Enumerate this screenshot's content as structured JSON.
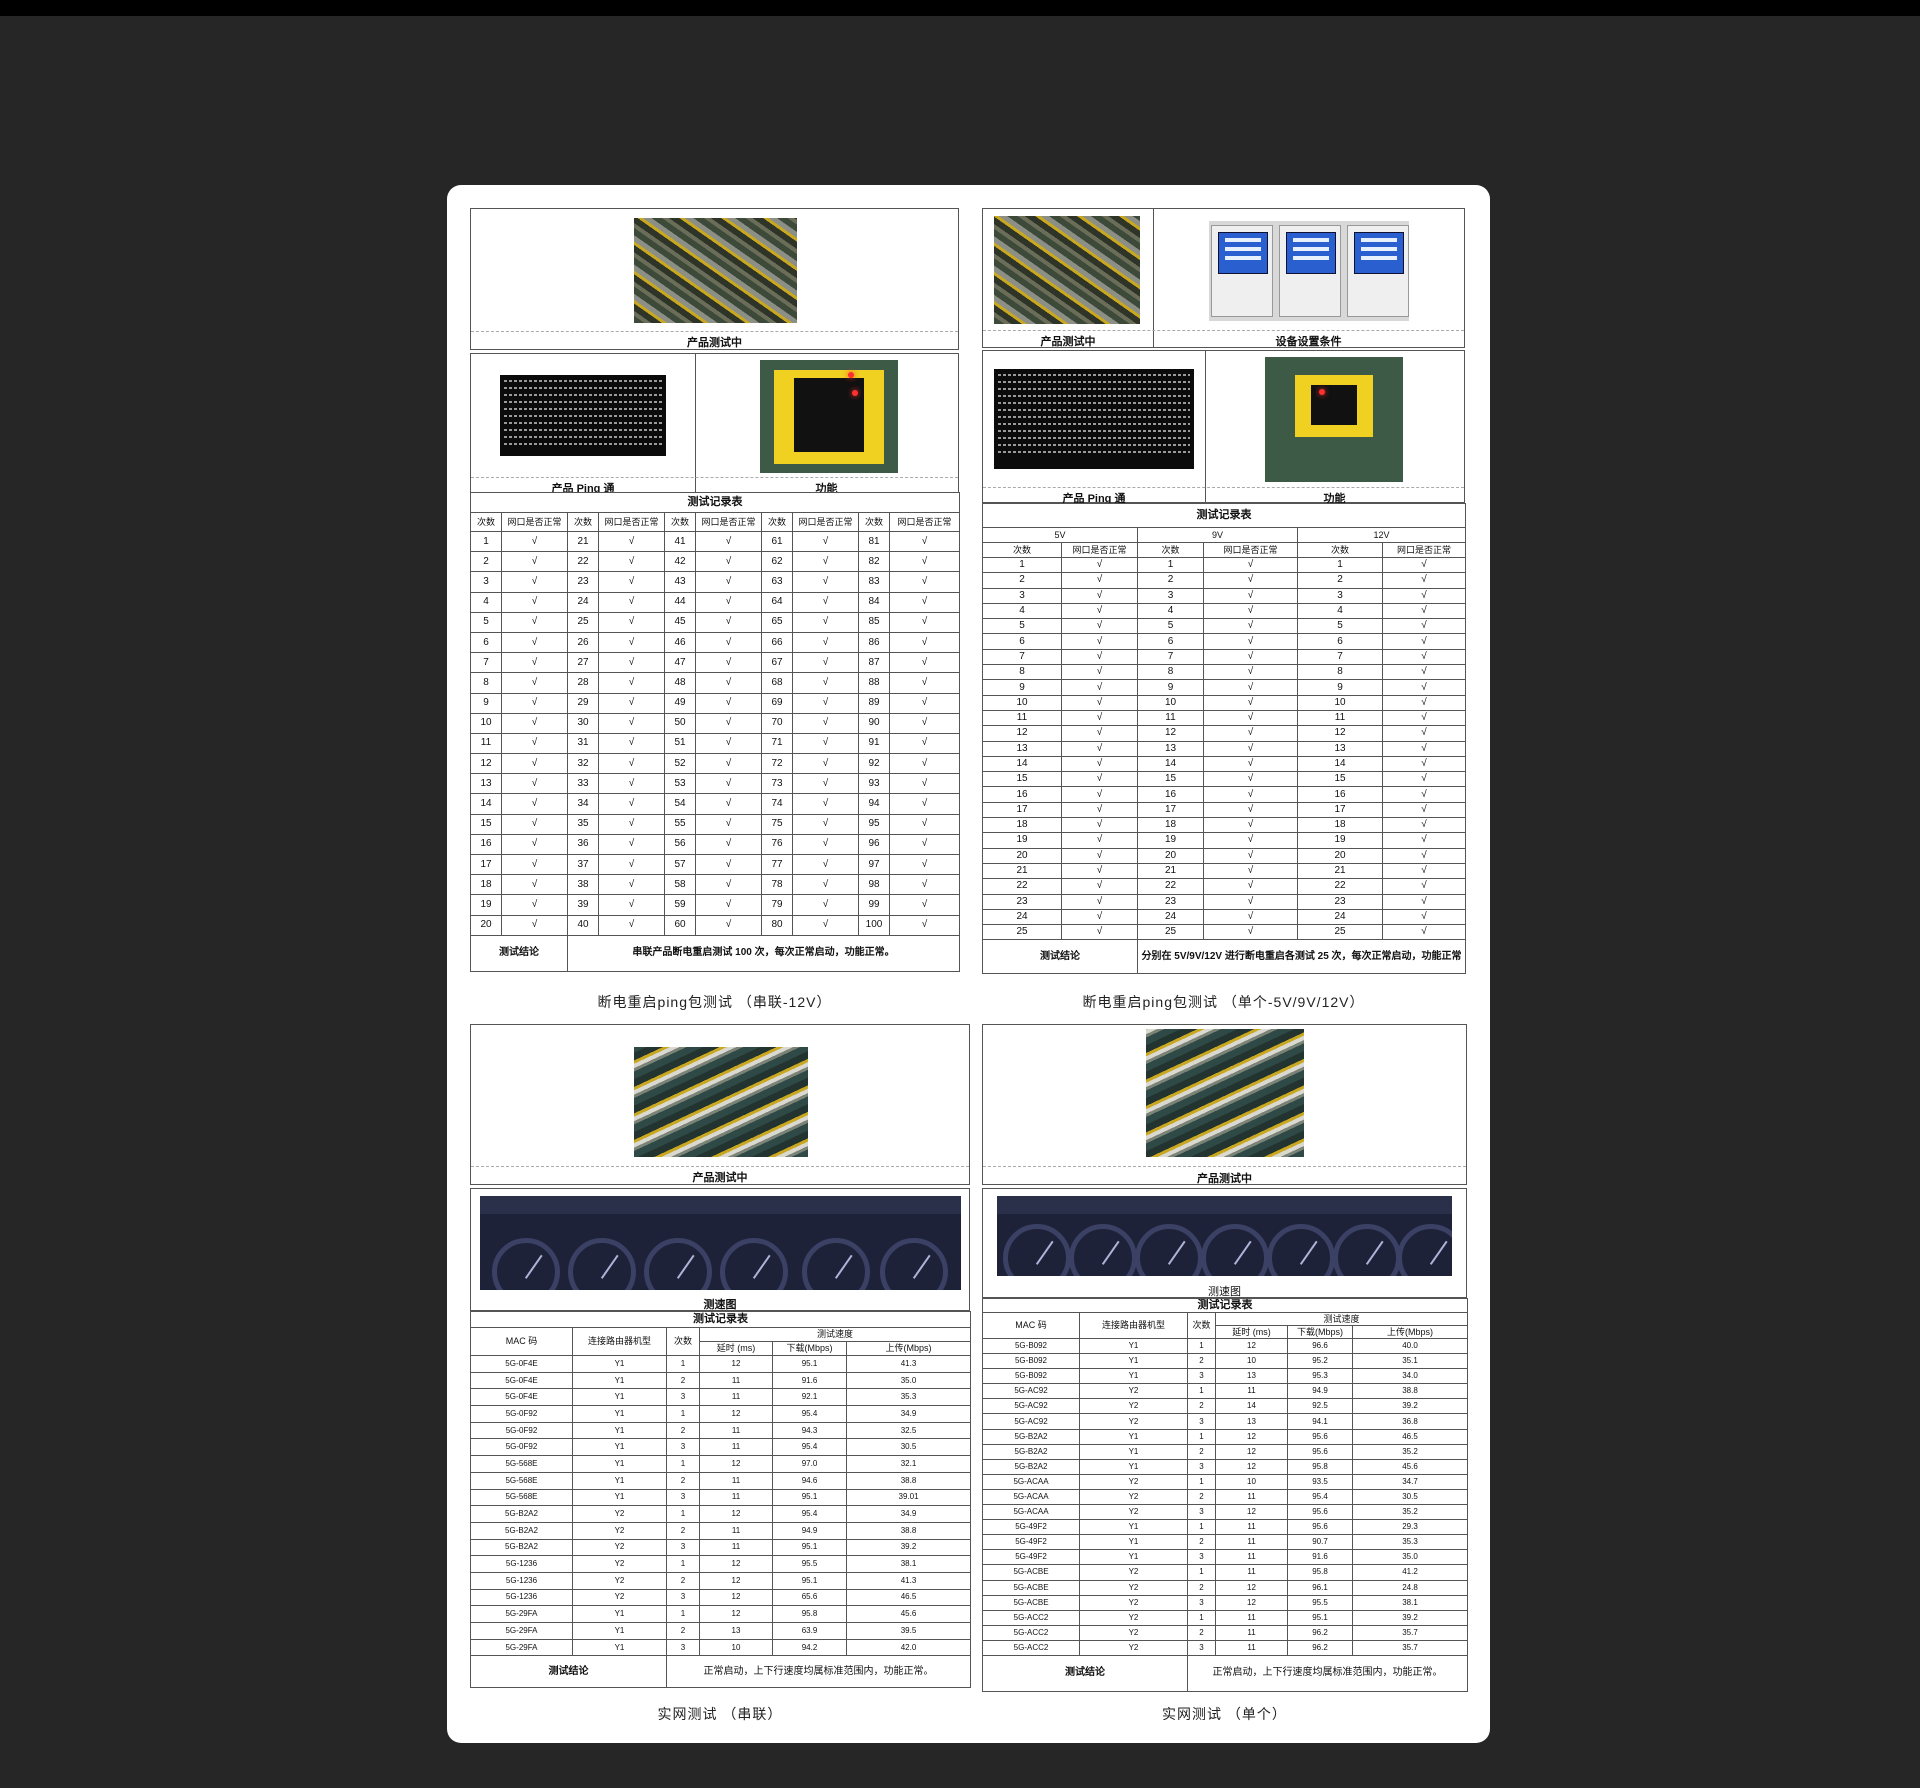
{
  "panel1": {
    "caption_photo": "产品测试中",
    "caption_ping": "产品 Ping 通",
    "caption_func": "功能",
    "table_title": "测试记录表",
    "col_count": "次数",
    "col_status": "网口是否正常",
    "check": "√",
    "conclusion_label": "测试结论",
    "conclusion_text": "串联产品断电重启测试 100 次，每次正常启动，功能正常。",
    "section_caption": "断电重启ping包测试 （串联-12V）"
  },
  "panel2": {
    "caption_photo": "产品测试中",
    "caption_setting": "设备设置条件",
    "caption_ping": "产品 Ping 通",
    "caption_func": "功能",
    "table_title": "测试记录表",
    "voltages": [
      "5V",
      "9V",
      "12V"
    ],
    "col_count": "次数",
    "col_status": "网口是否正常",
    "check": "√",
    "conclusion_label": "测试结论",
    "conclusion_text": "分别在 5V/9V/12V 进行断电重启各测试 25 次，每次正常启动，功能正常",
    "section_caption": "断电重启ping包测试 （单个-5V/9V/12V）"
  },
  "panel3": {
    "caption_photo": "产品测试中",
    "caption_speed": "测速图",
    "table_title": "测试记录表",
    "headers": {
      "mac": "MAC 码",
      "router": "连接路由器机型",
      "count": "次数",
      "speed": "测试速度",
      "latency": "延时 (ms)",
      "down": "下载(Mbps)",
      "up": "上传(Mbps)"
    },
    "rows": [
      [
        "5G-0F4E",
        "Y1",
        "1",
        "12",
        "95.1",
        "41.3"
      ],
      [
        "5G-0F4E",
        "Y1",
        "2",
        "11",
        "91.6",
        "35.0"
      ],
      [
        "5G-0F4E",
        "Y1",
        "3",
        "11",
        "92.1",
        "35.3"
      ],
      [
        "5G-0F92",
        "Y1",
        "1",
        "12",
        "95.4",
        "34.9"
      ],
      [
        "5G-0F92",
        "Y1",
        "2",
        "11",
        "94.3",
        "32.5"
      ],
      [
        "5G-0F92",
        "Y1",
        "3",
        "11",
        "95.4",
        "30.5"
      ],
      [
        "5G-568E",
        "Y1",
        "1",
        "12",
        "97.0",
        "32.1"
      ],
      [
        "5G-568E",
        "Y1",
        "2",
        "11",
        "94.6",
        "38.8"
      ],
      [
        "5G-568E",
        "Y1",
        "3",
        "11",
        "95.1",
        "39.01"
      ],
      [
        "5G-B2A2",
        "Y2",
        "1",
        "12",
        "95.4",
        "34.9"
      ],
      [
        "5G-B2A2",
        "Y2",
        "2",
        "11",
        "94.9",
        "38.8"
      ],
      [
        "5G-B2A2",
        "Y2",
        "3",
        "11",
        "95.1",
        "39.2"
      ],
      [
        "5G-1236",
        "Y2",
        "1",
        "12",
        "95.5",
        "38.1"
      ],
      [
        "5G-1236",
        "Y2",
        "2",
        "12",
        "95.1",
        "41.3"
      ],
      [
        "5G-1236",
        "Y2",
        "3",
        "12",
        "65.6",
        "46.5"
      ],
      [
        "5G-29FA",
        "Y1",
        "1",
        "12",
        "95.8",
        "45.6"
      ],
      [
        "5G-29FA",
        "Y1",
        "2",
        "13",
        "63.9",
        "39.5"
      ],
      [
        "5G-29FA",
        "Y1",
        "3",
        "10",
        "94.2",
        "42.0"
      ]
    ],
    "conclusion_label": "测试结论",
    "conclusion_text": "正常启动，上下行速度均属标准范围内，功能正常。",
    "section_caption": "实网测试 （串联）"
  },
  "panel4": {
    "caption_photo": "产品测试中",
    "caption_speed": "测速图",
    "table_title": "测试记录表",
    "headers": {
      "mac": "MAC 码",
      "router": "连接路由器机型",
      "count": "次数",
      "speed": "测试速度",
      "latency": "延时 (ms)",
      "down": "下载(Mbps)",
      "up": "上传(Mbps)"
    },
    "rows": [
      [
        "5G-B092",
        "Y1",
        "1",
        "12",
        "96.6",
        "40.0"
      ],
      [
        "5G-B092",
        "Y1",
        "2",
        "10",
        "95.2",
        "35.1"
      ],
      [
        "5G-B092",
        "Y1",
        "3",
        "13",
        "95.3",
        "34.0"
      ],
      [
        "5G-AC92",
        "Y2",
        "1",
        "11",
        "94.9",
        "38.8"
      ],
      [
        "5G-AC92",
        "Y2",
        "2",
        "14",
        "92.5",
        "39.2"
      ],
      [
        "5G-AC92",
        "Y2",
        "3",
        "13",
        "94.1",
        "36.8"
      ],
      [
        "5G-B2A2",
        "Y1",
        "1",
        "12",
        "95.6",
        "46.5"
      ],
      [
        "5G-B2A2",
        "Y1",
        "2",
        "12",
        "95.6",
        "35.2"
      ],
      [
        "5G-B2A2",
        "Y1",
        "3",
        "12",
        "95.8",
        "45.6"
      ],
      [
        "5G-ACAA",
        "Y2",
        "1",
        "10",
        "93.5",
        "34.7"
      ],
      [
        "5G-ACAA",
        "Y2",
        "2",
        "11",
        "95.4",
        "30.5"
      ],
      [
        "5G-ACAA",
        "Y2",
        "3",
        "12",
        "95.6",
        "35.2"
      ],
      [
        "5G-49F2",
        "Y1",
        "1",
        "11",
        "95.6",
        "29.3"
      ],
      [
        "5G-49F2",
        "Y1",
        "2",
        "11",
        "90.7",
        "35.3"
      ],
      [
        "5G-49F2",
        "Y1",
        "3",
        "11",
        "91.6",
        "35.0"
      ],
      [
        "5G-ACBE",
        "Y2",
        "1",
        "11",
        "95.8",
        "41.2"
      ],
      [
        "5G-ACBE",
        "Y2",
        "2",
        "12",
        "96.1",
        "24.8"
      ],
      [
        "5G-ACBE",
        "Y2",
        "3",
        "12",
        "95.5",
        "38.1"
      ],
      [
        "5G-ACC2",
        "Y2",
        "1",
        "11",
        "95.1",
        "39.2"
      ],
      [
        "5G-ACC2",
        "Y2",
        "2",
        "11",
        "96.2",
        "35.7"
      ],
      [
        "5G-ACC2",
        "Y2",
        "3",
        "11",
        "96.2",
        "35.7"
      ]
    ],
    "conclusion_label": "测试结论",
    "conclusion_text": "正常启动，上下行速度均属标准范围内，功能正常。",
    "section_caption": "实网测试 （单个）"
  }
}
